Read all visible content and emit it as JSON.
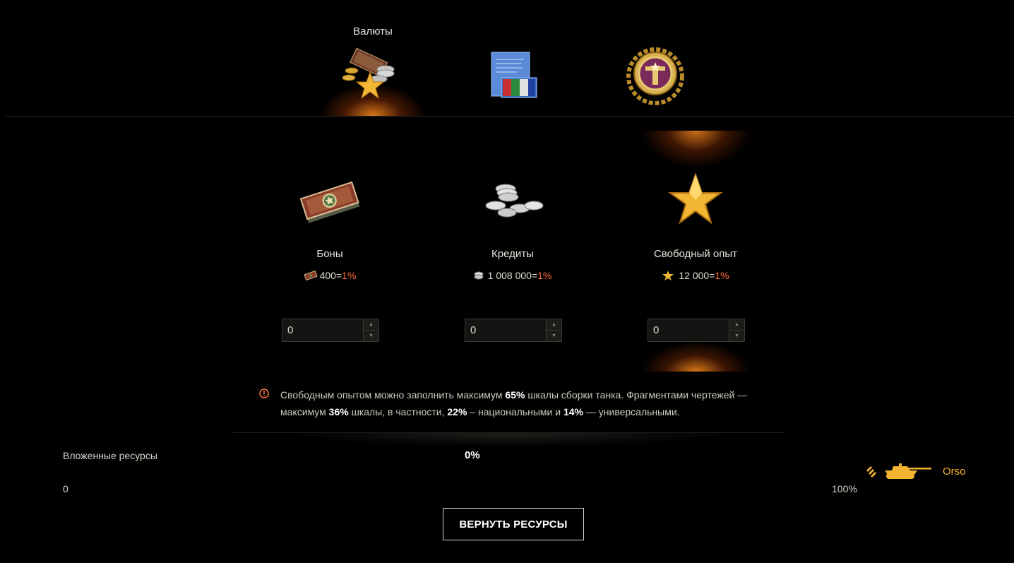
{
  "tabs": {
    "active_label": "Валюты",
    "items": [
      {
        "icon": "currency-stack-icon",
        "active": true
      },
      {
        "icon": "blueprint-documents-icon",
        "active": false
      },
      {
        "icon": "gold-emblem-icon",
        "active": false
      }
    ]
  },
  "currencies": [
    {
      "name": "Боны",
      "rate_amount": "400=",
      "rate_pct": "1%",
      "input_value": "0",
      "icon": "bonds-icon",
      "rate_icon": "bonds-small-icon"
    },
    {
      "name": "Кредиты",
      "rate_amount": "1 008 000=",
      "rate_pct": "1%",
      "input_value": "0",
      "icon": "credits-icon",
      "rate_icon": "credits-small-icon"
    },
    {
      "name": "Свободный опыт",
      "rate_amount": "12 000=",
      "rate_pct": "1%",
      "input_value": "0",
      "icon": "free-xp-star-icon",
      "rate_icon": "star-small-icon",
      "highlighted": true
    }
  ],
  "note": {
    "t1": "Свободным опытом можно заполнить максимум ",
    "b1": "65%",
    "t2": " шкалы сборки танка. Фрагментами чертежей — максимум ",
    "b2": "36%",
    "t3": " шкалы, в частности, ",
    "b3": "22%",
    "t4": " – национальными и ",
    "b4": "14%",
    "t5": " — универсальными."
  },
  "progress": {
    "label": "Вложенные ресурсы",
    "percent": "0%",
    "min_label": "0",
    "max_label": "100%"
  },
  "tank": {
    "name": "Orso",
    "color": "#f2b431"
  },
  "return_button": "ВЕРНУТЬ РЕСУРСЫ",
  "colors": {
    "accent": "#ff6a3c",
    "glow": "#ff8c1e",
    "tank": "#f2b431"
  }
}
